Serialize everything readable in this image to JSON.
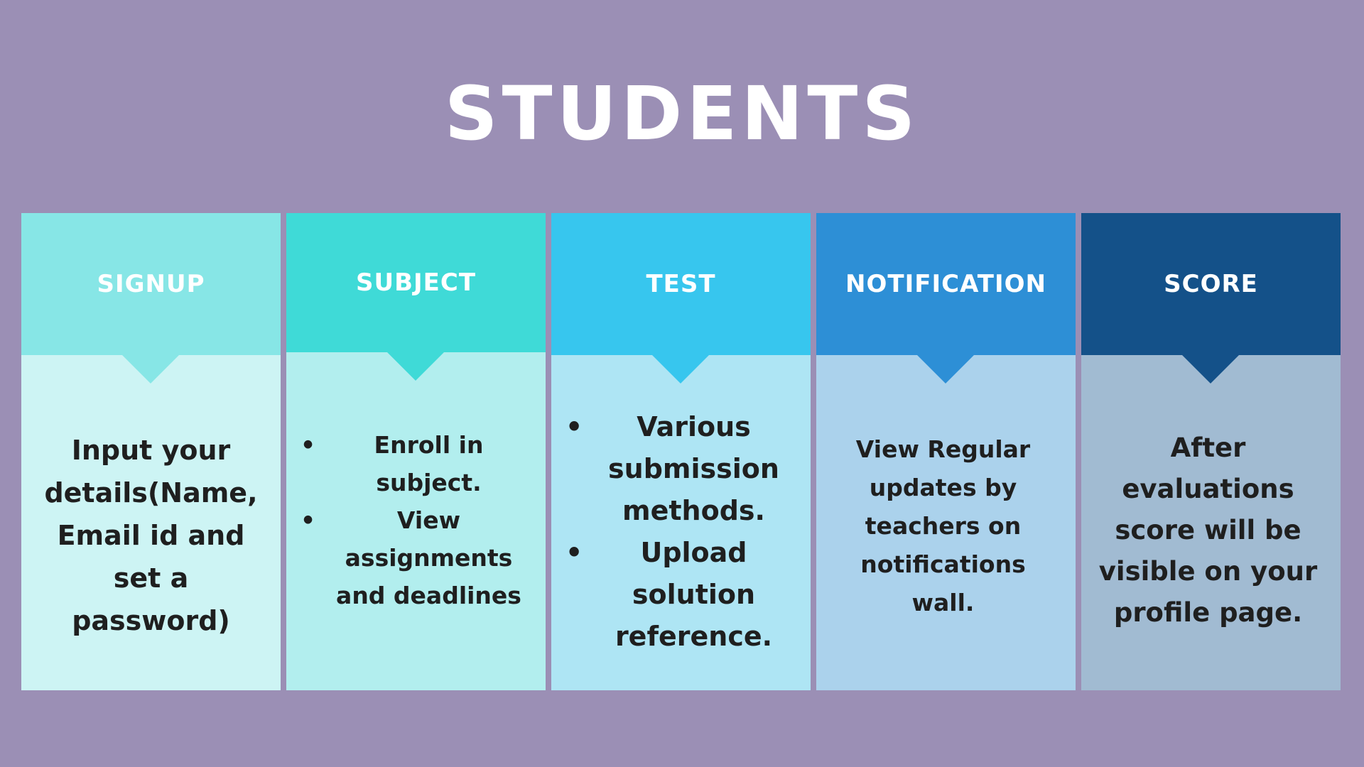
{
  "background_color": "#9b8fb5",
  "title": "STUDENTS",
  "cards": [
    {
      "id": "signup",
      "title": "SIGNUP",
      "header_color": "#87e6e6",
      "body_color": "#cdf4f4",
      "body": "Input your details(Name, Email id and set a password)"
    },
    {
      "id": "subject",
      "title": "SUBJECT",
      "header_color": "#3fdad7",
      "body_color": "#b2eeee",
      "bullets": [
        "Enroll in subject.",
        "View assignments and deadlines"
      ]
    },
    {
      "id": "test",
      "title": "TEST",
      "header_color": "#37c6ee",
      "body_color": "#aee5f4",
      "bullets": [
        "Various submission methods.",
        "Upload solution reference."
      ]
    },
    {
      "id": "notification",
      "title": "NOTIFICATION",
      "header_color": "#2d8fd6",
      "body_color": "#abd2ec",
      "body": "View Regular updates by teachers on notifications wall."
    },
    {
      "id": "score",
      "title": "SCORE",
      "header_color": "#145189",
      "body_color": "#a1bbd2",
      "body": "After evaluations score will be visible on your profile page."
    }
  ]
}
